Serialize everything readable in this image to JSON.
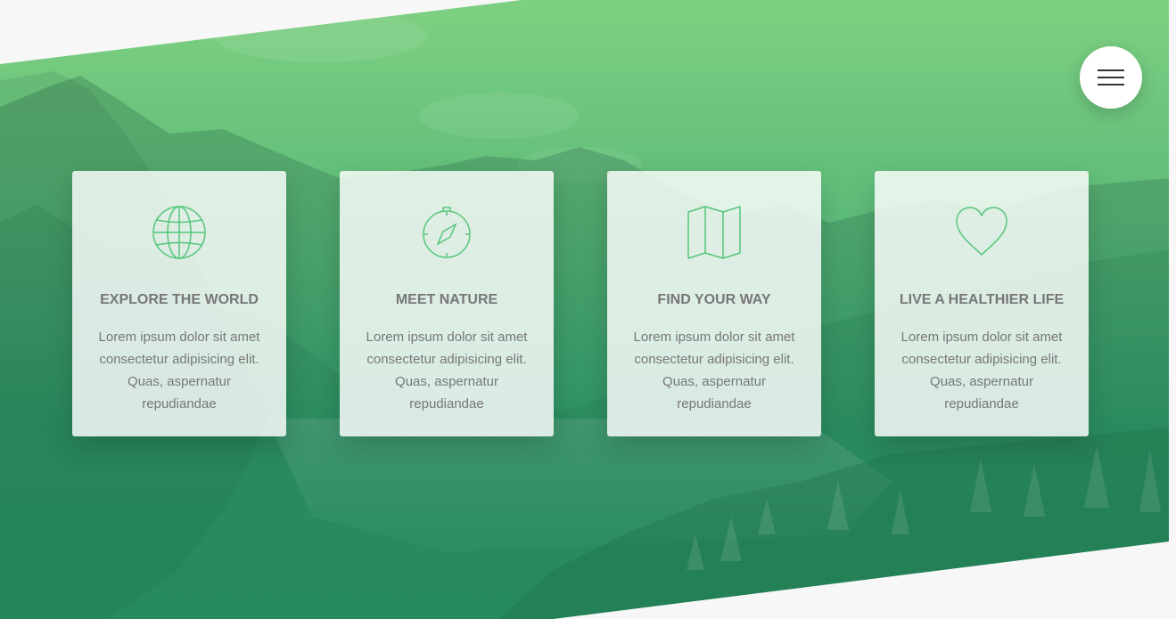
{
  "menu": {
    "icon": "hamburger-menu-icon"
  },
  "features": [
    {
      "icon": "globe-icon",
      "title": "EXPLORE THE WORLD",
      "text": "Lorem ipsum dolor sit amet consectetur adipisicing elit. Quas, aspernatur repudiandae"
    },
    {
      "icon": "compass-icon",
      "title": "MEET NATURE",
      "text": "Lorem ipsum dolor sit amet consectetur adipisicing elit. Quas, aspernatur repudiandae"
    },
    {
      "icon": "map-icon",
      "title": "FIND YOUR WAY",
      "text": "Lorem ipsum dolor sit amet consectetur adipisicing elit. Quas, aspernatur repudiandae"
    },
    {
      "icon": "heart-icon",
      "title": "LIVE A HEALTHIER LIFE",
      "text": "Lorem ipsum dolor sit amet consectetur adipisicing elit. Quas, aspernatur repudiandae"
    }
  ],
  "colors": {
    "gradient_top": "#7ed081",
    "gradient_bottom": "#2a9769",
    "icon_stroke": "#55c57a",
    "text": "#777777",
    "page_background": "#f7f7f7"
  }
}
